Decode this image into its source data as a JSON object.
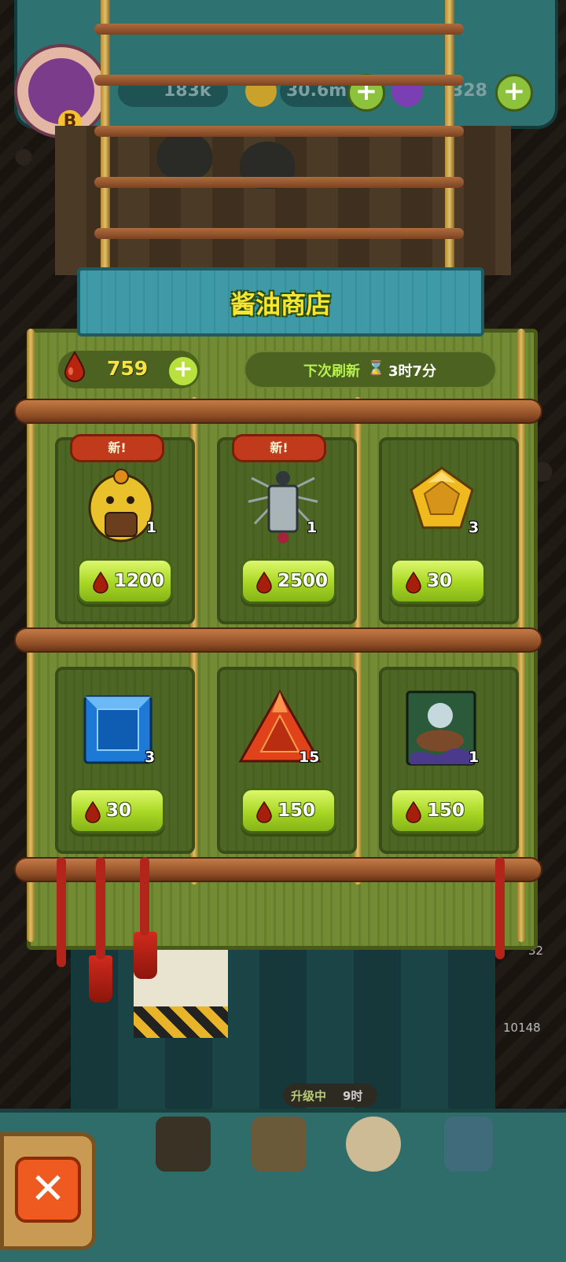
{
  "hud": {
    "resource_1": "183k",
    "resource_2": "30.6m",
    "resource_3": "328",
    "avatar_letter": "B"
  },
  "shop": {
    "title": "酱油商店",
    "currency_amount": "759",
    "refresh_label": "下次刷新",
    "refresh_time": "3时7分",
    "items": [
      {
        "name": "yellow-chick-creature",
        "is_new": true,
        "new_label": "新!",
        "quantity": "1",
        "price": "1200"
      },
      {
        "name": "gray-spiky-bird-creature",
        "is_new": true,
        "new_label": "新!",
        "quantity": "1",
        "price": "2500"
      },
      {
        "name": "gold-pentagon-gem",
        "is_new": false,
        "new_label": "",
        "quantity": "3",
        "price": "30"
      },
      {
        "name": "blue-square-gem",
        "is_new": false,
        "new_label": "",
        "quantity": "3",
        "price": "30"
      },
      {
        "name": "red-triangle-gem",
        "is_new": false,
        "new_label": "",
        "quantity": "15",
        "price": "150"
      },
      {
        "name": "skill-card",
        "is_new": false,
        "new_label": "",
        "quantity": "1",
        "price": "150"
      }
    ]
  },
  "background": {
    "upgrade_label": "升级中",
    "upgrade_time": "9时",
    "side_count_top": "32",
    "side_count": "10148"
  },
  "colors": {
    "accent_green": "#a8d623",
    "title_yellow": "#f7e62f",
    "new_tag_red": "#c23a1c",
    "close_orange": "#ef5a21"
  }
}
